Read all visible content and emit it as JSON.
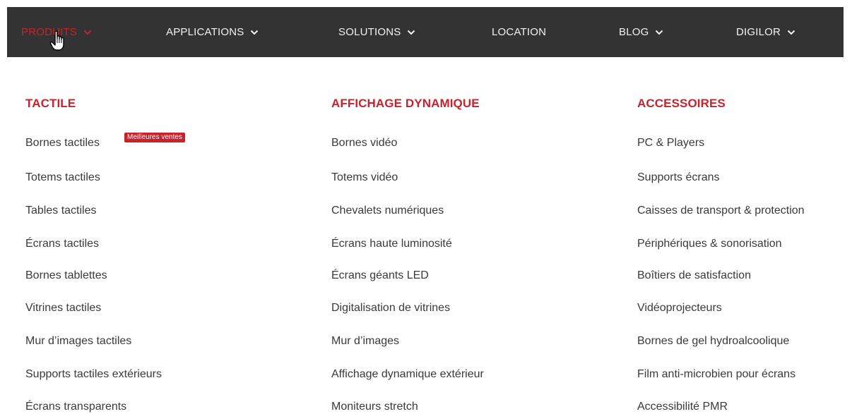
{
  "nav": {
    "items": [
      {
        "label": "PRODUITS",
        "active": true
      },
      {
        "label": "APPLICATIONS",
        "active": false
      },
      {
        "label": "SOLUTIONS",
        "active": false
      },
      {
        "label": "LOCATION",
        "active": false
      },
      {
        "label": "BLOG",
        "active": false
      },
      {
        "label": "DIGILOR",
        "active": false
      }
    ]
  },
  "menu": {
    "columns": [
      {
        "heading": "TACTILE",
        "items": [
          "Bornes tactiles",
          "Totems tactiles",
          "Tables tactiles",
          "Écrans tactiles",
          "Bornes tablettes",
          "Vitrines tactiles",
          "Mur d’images tactiles",
          "Supports tactiles extérieurs",
          "Écrans transparents"
        ],
        "badge": "Meilleures ventes"
      },
      {
        "heading": "AFFICHAGE DYNAMIQUE",
        "items": [
          "Bornes vidéo",
          "Totems vidéo",
          "Chevalets numériques",
          "Écrans haute luminosité",
          "Écrans géants LED",
          "Digitalisation de vitrines",
          "Mur d’images",
          "Affichage dynamique extérieur",
          "Moniteurs stretch"
        ]
      },
      {
        "heading": "ACCESSOIRES",
        "items": [
          "PC & Players",
          "Supports écrans",
          "Caisses de transport & protection",
          "Périphériques & sonorisation",
          "Boîtiers de satisfaction",
          "Vidéoprojecteurs",
          "Bornes de gel hydroalcoolique",
          "Film anti-microbien pour écrans",
          "Accessibilité PMR"
        ]
      }
    ]
  },
  "colors": {
    "accent": "#c8232c",
    "navbar_bg": "#333333",
    "nav_text": "#f2f2f2",
    "item_text": "#3a3a3a"
  },
  "icons": {
    "chevron": "chevron-down-icon",
    "cursor": "hand-pointer-cursor-icon"
  }
}
